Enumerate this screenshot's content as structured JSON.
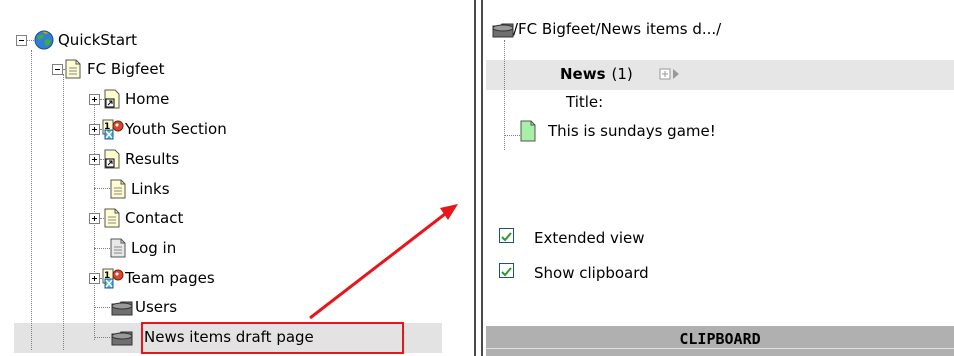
{
  "tree": {
    "root_label": "QuickStart",
    "site_label": "FC Bigfeet",
    "items": [
      {
        "label": "Home"
      },
      {
        "label": "Youth Section"
      },
      {
        "label": "Results"
      },
      {
        "label": "Links"
      },
      {
        "label": "Contact"
      },
      {
        "label": "Log in"
      },
      {
        "label": "Team pages"
      },
      {
        "label": "Users"
      },
      {
        "label": "News items draft page"
      }
    ]
  },
  "right": {
    "path": "/FC Bigfeet/News items d.../",
    "news_header": "News",
    "news_count": "(1)",
    "title_label": "Title:",
    "record_title": "This is sundays game!",
    "extended_view_label": "Extended view",
    "show_clipboard_label": "Show clipboard",
    "clipboard_title": "CLIPBOARD"
  },
  "colors": {
    "annotation_red": "#e8151b",
    "page_icon_fill": "#fffdd0",
    "record_icon_fill": "#a8f0a8",
    "check_green": "#2d9a2d"
  }
}
